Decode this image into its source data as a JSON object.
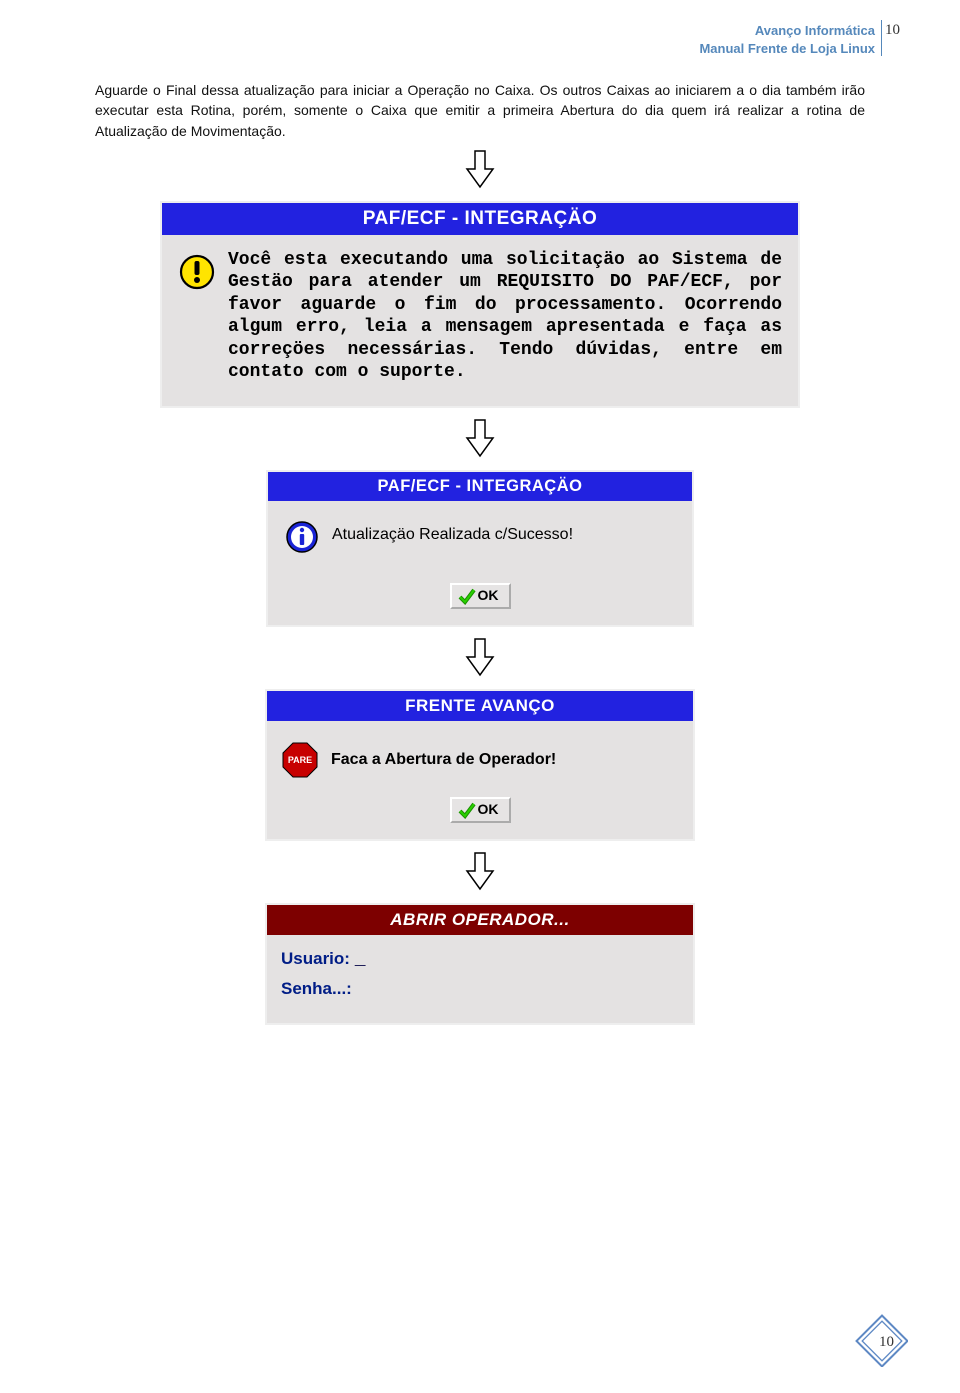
{
  "header": {
    "line1": "Avanço Informática",
    "line2": "Manual Frente de Loja Linux",
    "page_number_top": "10"
  },
  "body": {
    "paragraph": "Aguarde o Final dessa atualização para iniciar a Operação no Caixa. Os outros Caixas ao iniciarem a o dia também irão executar esta Rotina, porém, somente o Caixa que emitir a primeira Abertura do dia quem irá realizar a rotina de Atualização de Movimentação."
  },
  "dialog1": {
    "title": "PAF/ECF - INTEGRAÇÄO",
    "text": "Você esta executando uma  solicitaçäo ao Sistema  de  Gestäo  para  atender  um REQUISITO DO PAF/ECF, por  favor aguarde o fim do processamento.  Ocorrendo algum erro, leia a mensagem apresentada e faça as correçöes necessárias. Tendo dúvidas, entre em contato com o suporte.",
    "alert_icon_name": "exclamation-warning-icon"
  },
  "dialog2": {
    "title": "PAF/ECF - INTEGRAÇÄO",
    "text": "Atualizaçäo Realizada c/Sucesso!",
    "ok_label": "OK",
    "info_icon_name": "info-icon"
  },
  "dialog3": {
    "title": "FRENTE AVANÇO",
    "text": "Faca a Abertura de Operador!",
    "ok_label": "OK",
    "stop_icon_name": "pare-stop-icon",
    "stop_icon_text": "PARE"
  },
  "dialog4": {
    "title": "ABRIR OPERADOR...",
    "user_label": "Usuario:",
    "user_value": "_",
    "pass_label": "Senha...:"
  },
  "footer": {
    "page_number": "10"
  },
  "colors": {
    "header_blue": "#5588bb",
    "titlebar_blue": "#2222e0",
    "titlebar_dark_red": "#7d0000",
    "login_label": "#001d86",
    "dialog_bg": "#e4e2e2"
  }
}
